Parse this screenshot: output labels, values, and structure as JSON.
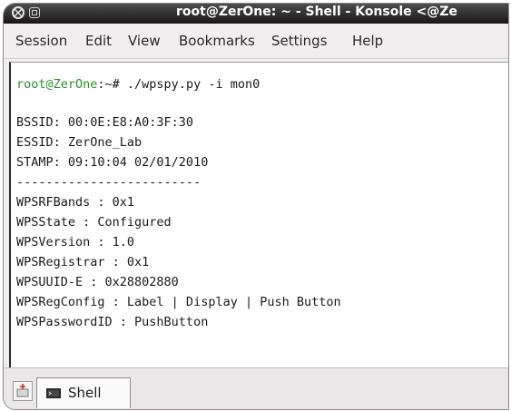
{
  "window": {
    "title": "root@ZerOne: ~ - Shell - Konsole <@Ze"
  },
  "menubar": {
    "items": [
      "Session",
      "Edit",
      "View",
      "Bookmarks",
      "Settings",
      "Help"
    ]
  },
  "terminal": {
    "prompt_user": "root@ZerOne",
    "prompt_rest": ":~# ./wpspy.py -i mon0",
    "lines": [
      "BSSID: 00:0E:E8:A0:3F:30",
      "ESSID: ZerOne_Lab",
      "STAMP: 09:10:04 02/01/2010",
      "-------------------------",
      "WPSRFBands : 0x1",
      "WPSState : Configured",
      "WPSVersion : 1.0",
      "WPSRegistrar : 0x1",
      "WPSUUID-E : 0x28802880",
      "WPSRegConfig : Label | Display | Push Button",
      "WPSPasswordID : PushButton"
    ]
  },
  "tabs": [
    {
      "label": "Shell",
      "icon": "terminal-icon"
    }
  ]
}
